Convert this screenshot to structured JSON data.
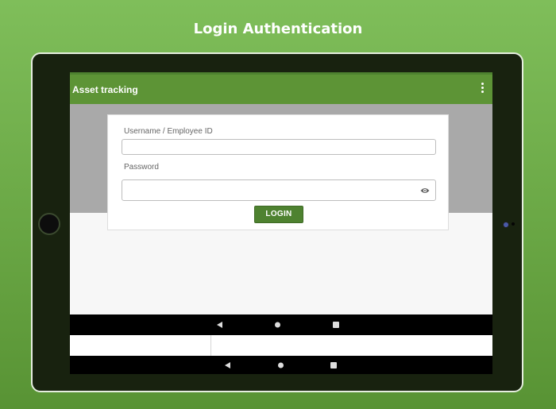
{
  "promo": {
    "headline": "Login Authentication"
  },
  "app": {
    "title": "Asset tracking",
    "menu_icon": "overflow-menu-icon"
  },
  "login_form": {
    "username_label": "Username / Employee ID",
    "username_value": "",
    "password_label": "Password",
    "password_value": "",
    "password_toggle_icon": "eye-icon",
    "login_button_label": "LOGIN"
  },
  "system_nav": {
    "icons": [
      "back-icon",
      "home-icon",
      "recents-icon"
    ]
  },
  "colors": {
    "background_green": "#6aa745",
    "appbar_green": "#5d9436",
    "button_green": "#4e8230",
    "tablet_frame": "#18220f"
  }
}
